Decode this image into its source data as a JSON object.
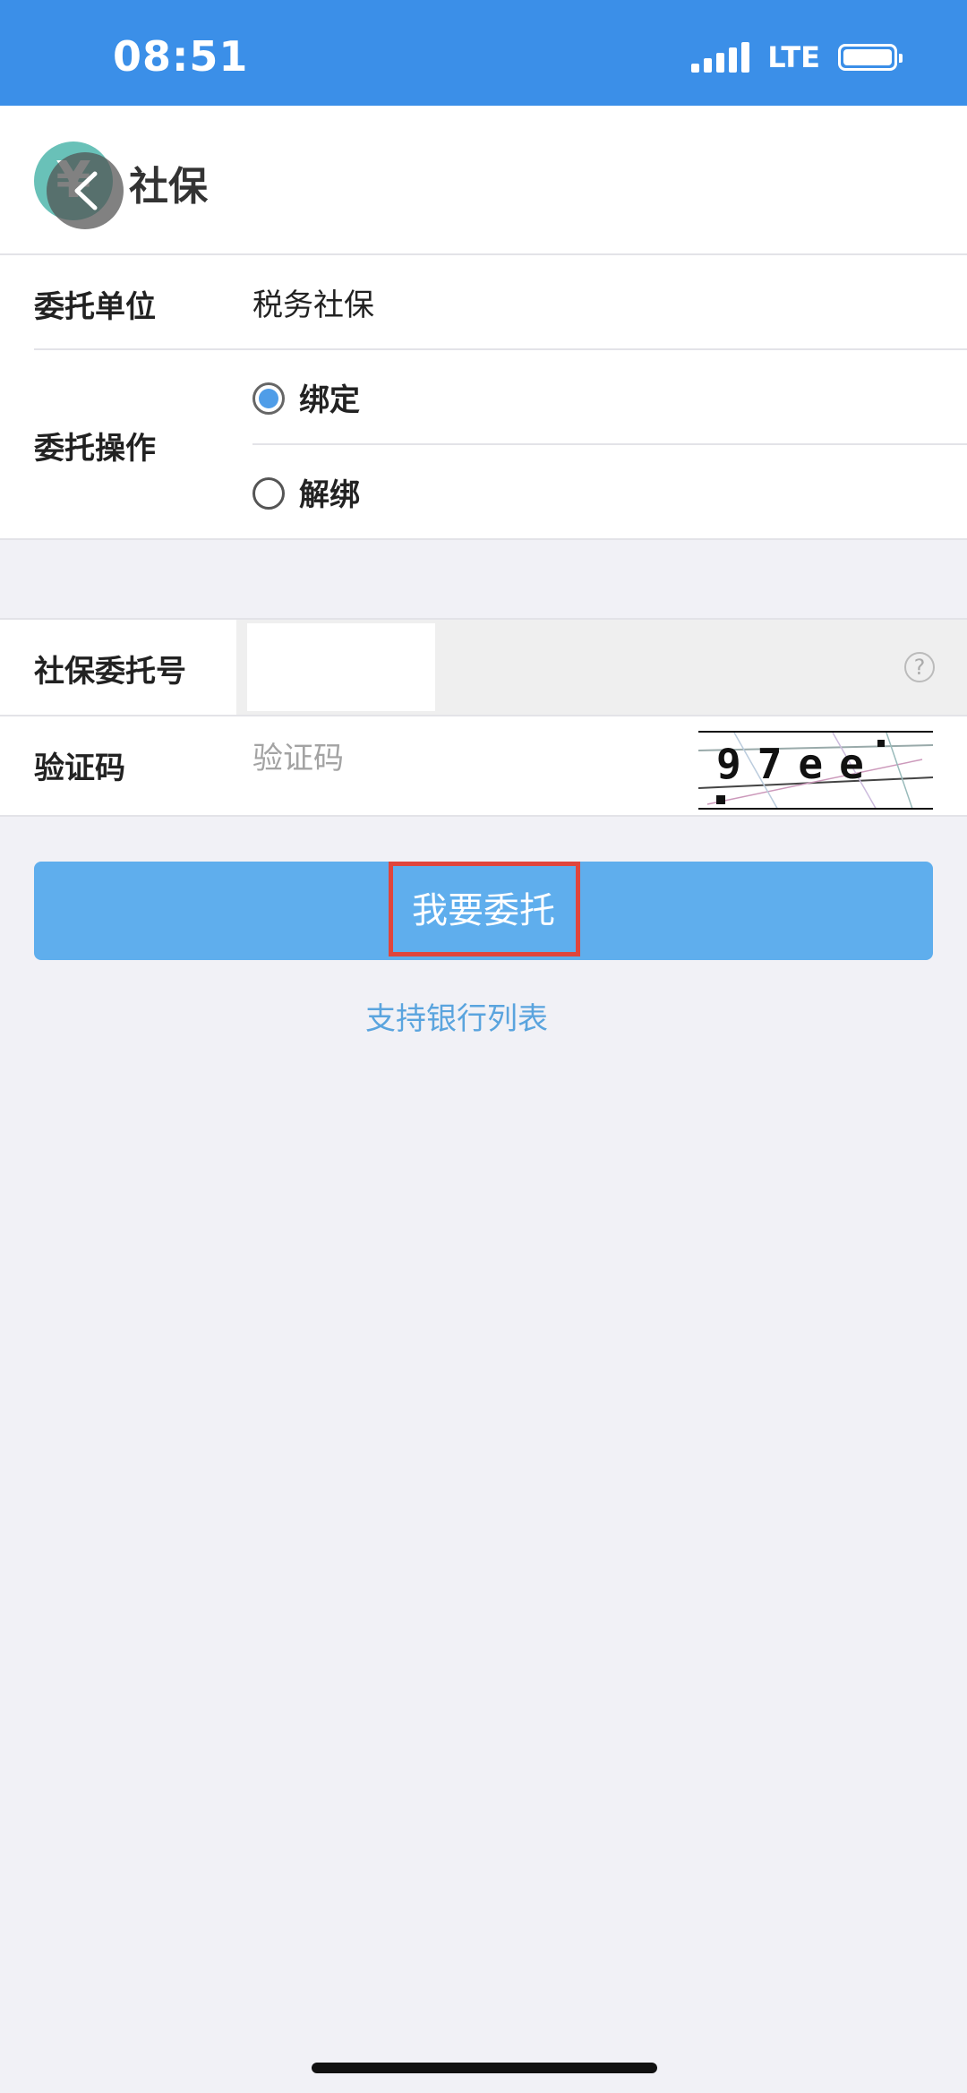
{
  "status_bar": {
    "time": "08:51",
    "network": "LTE",
    "icons": [
      "signal-icon",
      "battery-icon"
    ]
  },
  "header": {
    "logo_glyph": "¥",
    "title": "社保",
    "icons": [
      "back-icon"
    ]
  },
  "form": {
    "unit_label": "委托单位",
    "unit_value": "税务社保",
    "operation_label": "委托操作",
    "operation_options": [
      {
        "label": "绑定",
        "checked": true
      },
      {
        "label": "解绑",
        "checked": false
      }
    ],
    "entrust_no_label": "社保委托号",
    "entrust_no_value": "",
    "captcha_label": "验证码",
    "captcha_placeholder": "验证码",
    "captcha_text": "97ee"
  },
  "actions": {
    "submit_label": "我要委托",
    "bank_list_link": "支持银行列表"
  },
  "colors": {
    "status_bar": "#3b8fe8",
    "primary_button": "#5faeed",
    "highlight": "#e0453c",
    "link": "#5aa4de",
    "radio_checked": "#4f9de8",
    "page_background": "#f1f1f6"
  }
}
